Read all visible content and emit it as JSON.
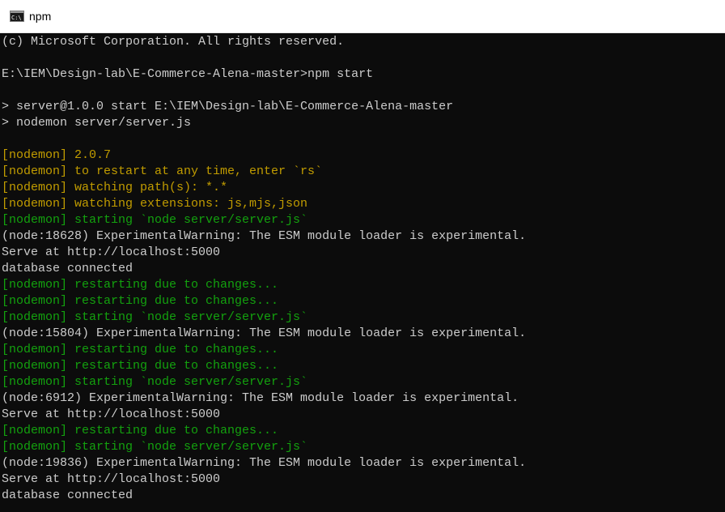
{
  "window": {
    "title": "npm",
    "icon": "console-icon"
  },
  "colors": {
    "background": "#0c0c0c",
    "default_text": "#cccccc",
    "nodemon_yellow": "#c19c00",
    "nodemon_green": "#13a10e"
  },
  "console": {
    "lines": [
      {
        "text": "(c) Microsoft Corporation. All rights reserved.",
        "color": "default"
      },
      {
        "text": "",
        "color": "default"
      },
      {
        "text": "E:\\IEM\\Design-lab\\E-Commerce-Alena-master>npm start",
        "color": "default"
      },
      {
        "text": "",
        "color": "default"
      },
      {
        "text": "> server@1.0.0 start E:\\IEM\\Design-lab\\E-Commerce-Alena-master",
        "color": "default"
      },
      {
        "text": "> nodemon server/server.js",
        "color": "default"
      },
      {
        "text": "",
        "color": "default"
      },
      {
        "text": "[nodemon] 2.0.7",
        "color": "yellow"
      },
      {
        "text": "[nodemon] to restart at any time, enter `rs`",
        "color": "yellow"
      },
      {
        "text": "[nodemon] watching path(s): *.*",
        "color": "yellow"
      },
      {
        "text": "[nodemon] watching extensions: js,mjs,json",
        "color": "yellow"
      },
      {
        "text": "[nodemon] starting `node server/server.js`",
        "color": "green"
      },
      {
        "text": "(node:18628) ExperimentalWarning: The ESM module loader is experimental.",
        "color": "default"
      },
      {
        "text": "Serve at http://localhost:5000",
        "color": "default"
      },
      {
        "text": "database connected",
        "color": "default"
      },
      {
        "text": "[nodemon] restarting due to changes...",
        "color": "green"
      },
      {
        "text": "[nodemon] restarting due to changes...",
        "color": "green"
      },
      {
        "text": "[nodemon] starting `node server/server.js`",
        "color": "green"
      },
      {
        "text": "(node:15804) ExperimentalWarning: The ESM module loader is experimental.",
        "color": "default"
      },
      {
        "text": "[nodemon] restarting due to changes...",
        "color": "green"
      },
      {
        "text": "[nodemon] restarting due to changes...",
        "color": "green"
      },
      {
        "text": "[nodemon] starting `node server/server.js`",
        "color": "green"
      },
      {
        "text": "(node:6912) ExperimentalWarning: The ESM module loader is experimental.",
        "color": "default"
      },
      {
        "text": "Serve at http://localhost:5000",
        "color": "default"
      },
      {
        "text": "[nodemon] restarting due to changes...",
        "color": "green"
      },
      {
        "text": "[nodemon] starting `node server/server.js`",
        "color": "green"
      },
      {
        "text": "(node:19836) ExperimentalWarning: The ESM module loader is experimental.",
        "color": "default"
      },
      {
        "text": "Serve at http://localhost:5000",
        "color": "default"
      },
      {
        "text": "database connected",
        "color": "default"
      }
    ]
  }
}
